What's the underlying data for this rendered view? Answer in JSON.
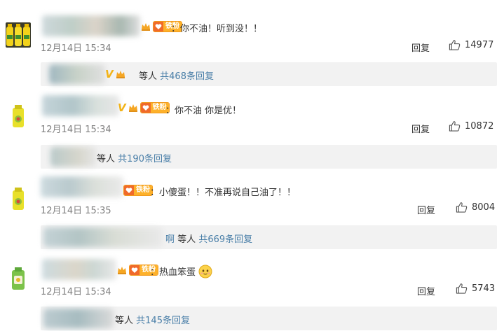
{
  "comments": [
    {
      "fan_label": "铁粉",
      "text": "：你不油！听到没！！",
      "time": "12月14日 15:34",
      "reply_label": "回复",
      "likes": "14977",
      "summary": {
        "suffix": "等人",
        "count": "共468条回复"
      }
    },
    {
      "fan_label": "铁粉",
      "text": "：你不油  你是优！",
      "time": "12月14日 15:34",
      "reply_label": "回复",
      "likes": "10872",
      "summary": {
        "suffix": "等人",
        "count": "共190条回复"
      }
    },
    {
      "fan_label": "铁粉",
      "text": "：小傻蛋！！不准再说自己油了！！",
      "time": "12月14日 15:35",
      "reply_label": "回复",
      "likes": "8004",
      "summary": {
        "name_tail": "啊",
        "suffix": "等人",
        "count": "共669条回复"
      }
    },
    {
      "fan_label": "铁粉",
      "text": "：热血笨蛋",
      "emoji": "smile-emoji",
      "time": "12月14日 15:34",
      "reply_label": "回复",
      "likes": "5743",
      "summary": {
        "suffix": "等人",
        "count": "共145条回复"
      }
    }
  ],
  "colors": {
    "accent_link": "#4a7fa8",
    "fan_badge": "#fdb12a",
    "vip": "#f2b318",
    "summary_bg": "#f2f2f2",
    "time": "#808080"
  },
  "icons": [
    "avatar-oil-bottles",
    "avatar-detergent-bottle",
    "vip-v-icon",
    "crown-icon",
    "fan-heart-icon",
    "thumbs-up-icon"
  ]
}
